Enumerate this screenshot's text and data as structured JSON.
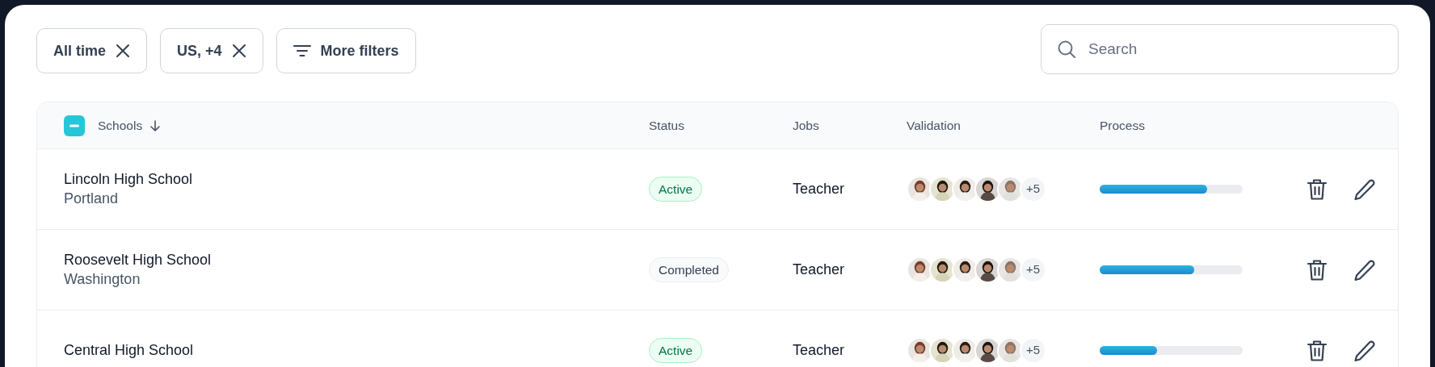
{
  "filters": [
    {
      "label": "All time",
      "kind": "removable"
    },
    {
      "label": "US, +4",
      "kind": "removable"
    },
    {
      "label": "More filters",
      "kind": "menu"
    }
  ],
  "search": {
    "placeholder": "Search"
  },
  "table": {
    "select_all": {
      "indeterminate": true
    },
    "columns": [
      {
        "label": "Schools",
        "sorted_descending": true
      },
      {
        "label": "Status"
      },
      {
        "label": "Jobs"
      },
      {
        "label": "Validation"
      },
      {
        "label": "Process"
      }
    ],
    "rows": [
      {
        "school": "Lincoln High School",
        "city": "Portland",
        "status": {
          "label": "Active",
          "kind": "success"
        },
        "job": "Teacher",
        "validators": {
          "more": "+5"
        },
        "level": 0.75
      },
      {
        "school": "Roosevelt High School",
        "city": "Washington",
        "status": {
          "label": "Completed",
          "kind": "neutral"
        },
        "job": "Teacher",
        "validators": {
          "more": "+5"
        },
        "level": 0.66
      },
      {
        "school": "Central High School",
        "status": {
          "label": "Active",
          "kind": "success"
        },
        "job": "Teacher",
        "validators": {
          "more": "+5"
        },
        "level": 0.4
      }
    ]
  }
}
